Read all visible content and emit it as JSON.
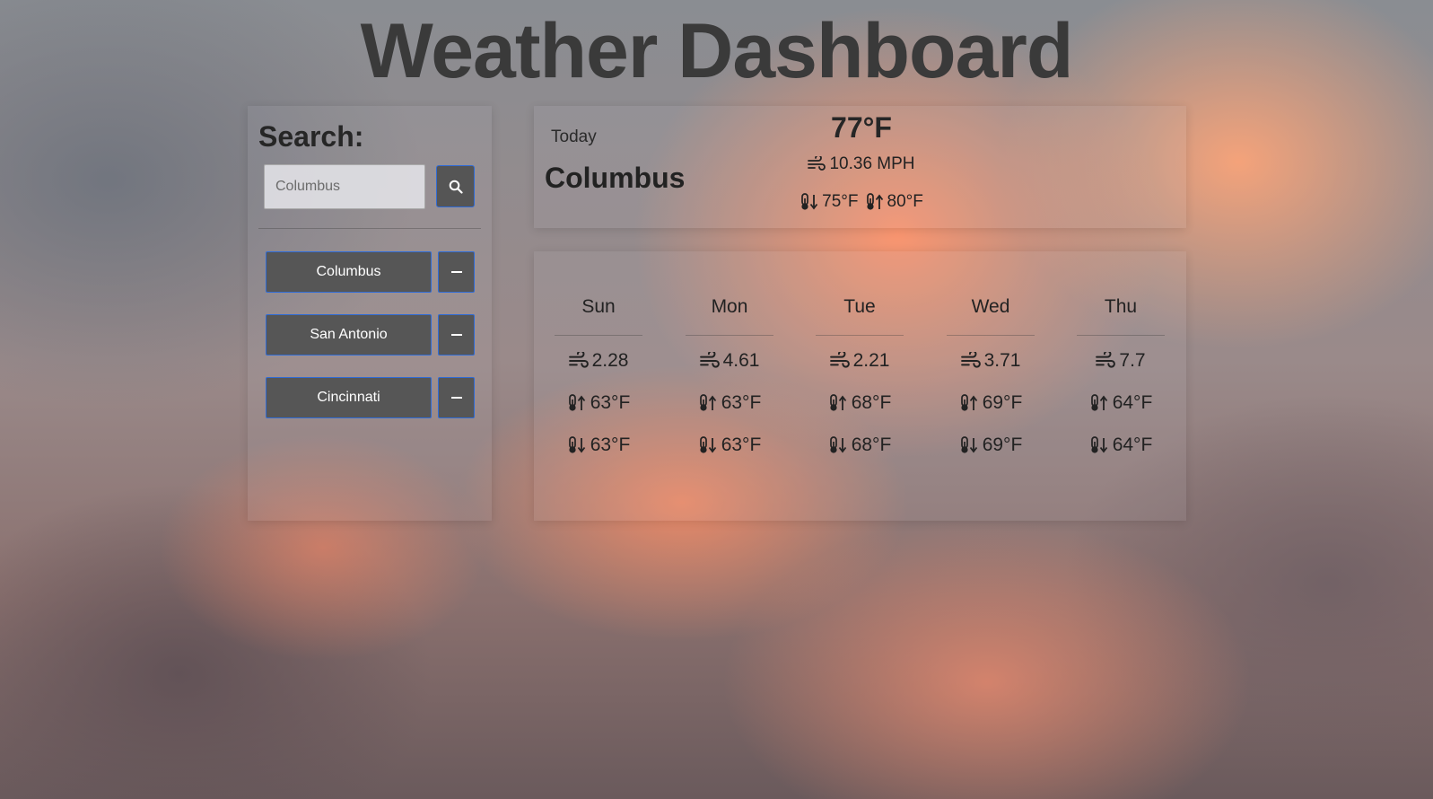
{
  "title": "Weather Dashboard",
  "search": {
    "heading": "Search:",
    "placeholder": "Columbus",
    "button_icon": "search-icon"
  },
  "saved_cities": [
    {
      "label": "Columbus",
      "remove_icon": "minus-icon"
    },
    {
      "label": "San Antonio",
      "remove_icon": "minus-icon"
    },
    {
      "label": "Cincinnati",
      "remove_icon": "minus-icon"
    }
  ],
  "today": {
    "label": "Today",
    "city": "Columbus",
    "temp": "77°F",
    "wind": "10.36 MPH",
    "low": "75°F",
    "high": "80°F"
  },
  "forecast": [
    {
      "day": "Sun",
      "wind": "2.28",
      "high": "63°F",
      "low": "63°F"
    },
    {
      "day": "Mon",
      "wind": "4.61",
      "high": "63°F",
      "low": "63°F"
    },
    {
      "day": "Tue",
      "wind": "2.21",
      "high": "68°F",
      "low": "68°F"
    },
    {
      "day": "Wed",
      "wind": "3.71",
      "high": "69°F",
      "low": "69°F"
    },
    {
      "day": "Thu",
      "wind": "7.7",
      "high": "64°F",
      "low": "64°F"
    }
  ],
  "icons": {
    "wind": "wind-icon",
    "temp_high": "thermometer-up-icon",
    "temp_low": "thermometer-down-icon"
  },
  "colors": {
    "button_bg": "#565656",
    "button_border": "#2f6bd6",
    "title_text": "#3a3a3a"
  }
}
